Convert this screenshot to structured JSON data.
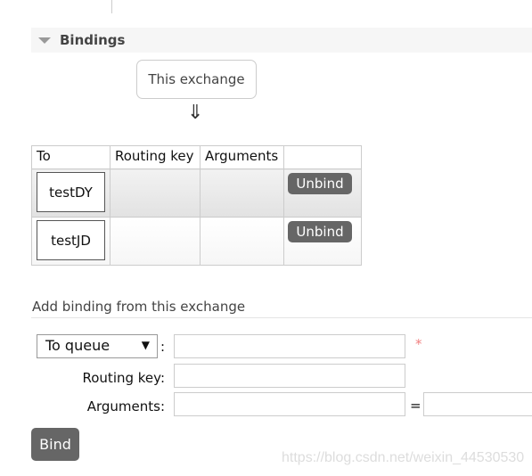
{
  "bindings_section": {
    "title": "Bindings",
    "source_label": "This exchange",
    "arrow": "⇓",
    "table": {
      "columns": [
        "To",
        "Routing key",
        "Arguments",
        ""
      ],
      "rows": [
        {
          "to": "testDY",
          "routing_key": "",
          "arguments": "",
          "action": "Unbind"
        },
        {
          "to": "testJD",
          "routing_key": "",
          "arguments": "",
          "action": "Unbind"
        }
      ]
    }
  },
  "add_binding": {
    "title": "Add binding from this exchange",
    "destination_select": "To queue",
    "colon": ":",
    "required_mark": "*",
    "routing_key_label": "Routing key:",
    "arguments_label": "Arguments:",
    "equals": "=",
    "bind_label": "Bind"
  },
  "watermark": "https://blog.csdn.net/weixin_44530530",
  "colors": {
    "button": "#666666",
    "required": "#f08080",
    "header_bg": "#f6f6f6"
  }
}
